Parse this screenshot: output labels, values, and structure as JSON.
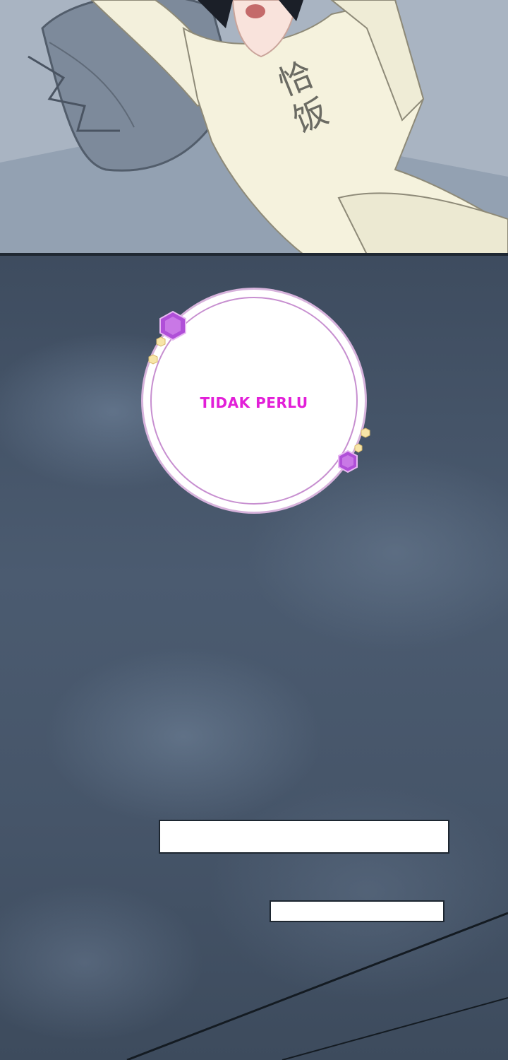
{
  "top_panel": {
    "shirt_text": "恰饭"
  },
  "speech_bubble": {
    "text": "TIDAK PERLU",
    "text_color": "#e21fd8",
    "accent_color": "#c05ad6"
  },
  "caption_boxes": [
    {
      "text": ""
    },
    {
      "text": ""
    }
  ]
}
